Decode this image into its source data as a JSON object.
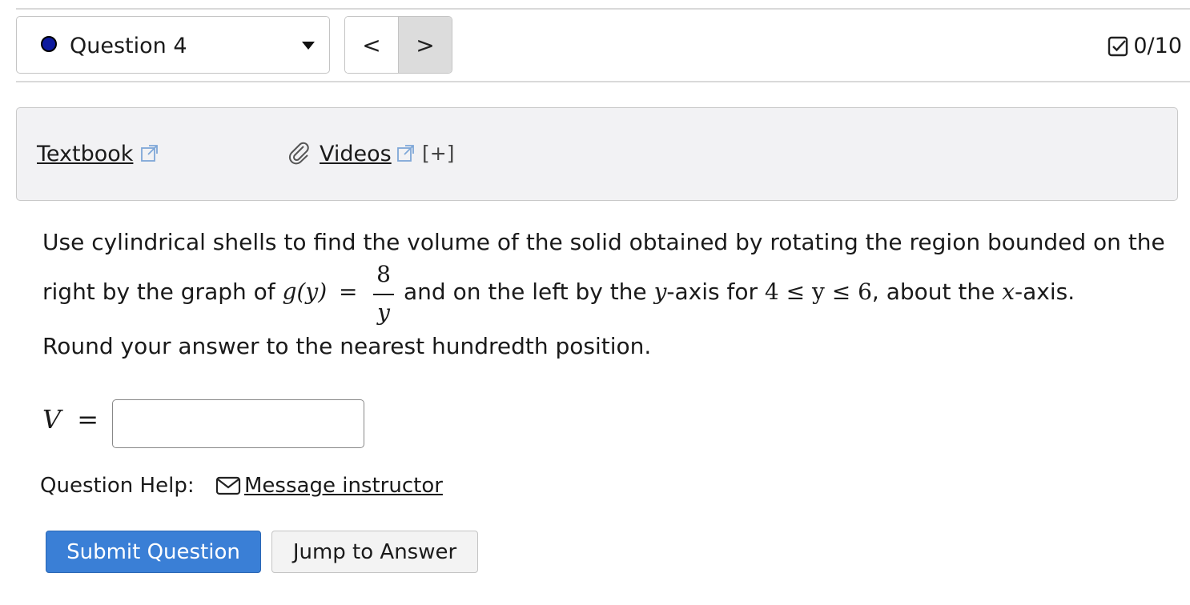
{
  "question_selector": {
    "label": "Question 4",
    "status_color": "#0d1a9e"
  },
  "nav": {
    "prev_glyph": "<",
    "next_glyph": ">"
  },
  "score": {
    "value": "0/10"
  },
  "resources": {
    "textbook": "Textbook",
    "videos": "Videos",
    "more": "[+]"
  },
  "question": {
    "line1": "Use cylindrical shells to find the volume of the solid obtained by rotating the region bounded on the",
    "line2_a": "right by the graph of",
    "g_of_y": "g(y)",
    "equals": "=",
    "frac_num": "8",
    "frac_den": "y",
    "line2_b": "and on the left by the",
    "y_var": "y",
    "axis_for": "-axis for",
    "range": "4 ≤ y ≤ 6",
    "about_the": ", about the",
    "x_var": "x",
    "axis_end": "-axis.",
    "line3": "Round your answer to the nearest hundredth position."
  },
  "answer": {
    "var": "V",
    "equals": "=",
    "value": ""
  },
  "help": {
    "label": "Question Help:",
    "message_link": "Message instructor"
  },
  "buttons": {
    "submit": "Submit Question",
    "jump": "Jump to Answer"
  },
  "colors": {
    "submit_bg": "#3a7fd6",
    "panel_bg": "#f2f2f4"
  }
}
